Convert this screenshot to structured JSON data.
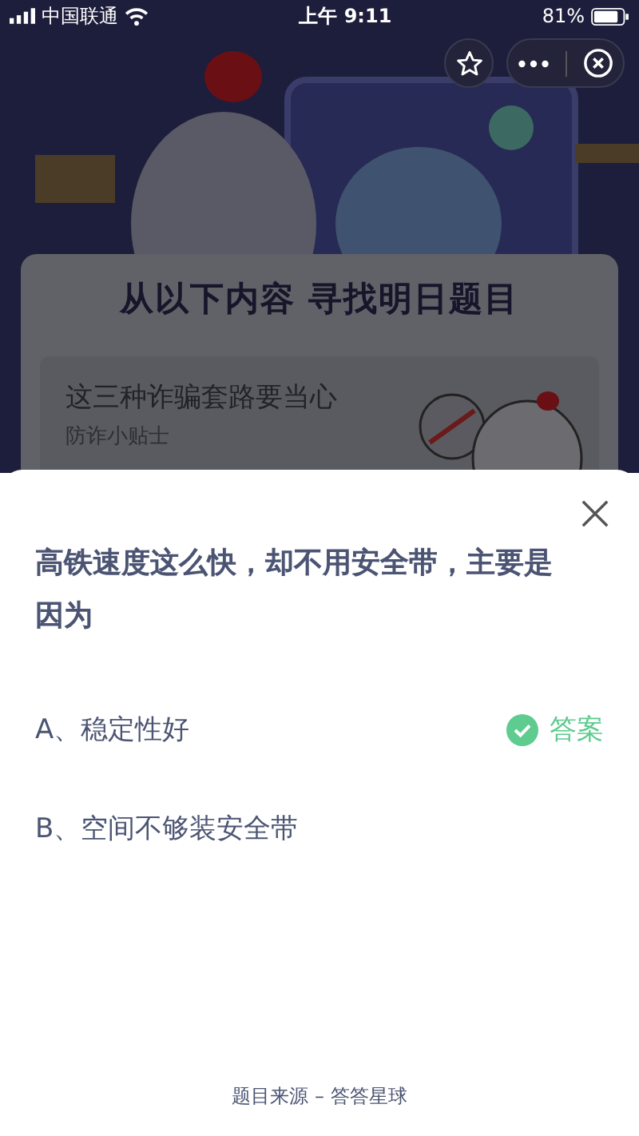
{
  "status_bar": {
    "carrier": "中国联通",
    "time": "上午 9:11",
    "battery": "81%"
  },
  "banner": {
    "kind": "picture",
    "heading": "从以下内容 寻找明日题目"
  },
  "article": {
    "title": "这三种诈骗套路要当心",
    "subtitle": "防诈小贴士"
  },
  "question": {
    "text": "高铁速度这么快，却不用安全带，主要是因为",
    "options": [
      {
        "label": "A、稳定性好",
        "correct": true,
        "tag": "答案"
      },
      {
        "label": "B、空间不够装安全带",
        "correct": false
      }
    ]
  },
  "footer": "题目来源 – 答答星球"
}
